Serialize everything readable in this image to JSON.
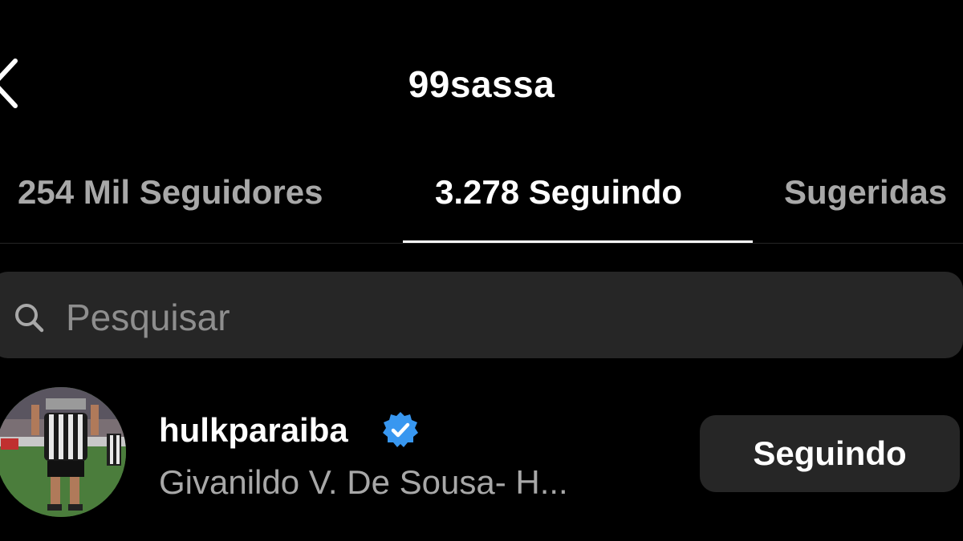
{
  "header": {
    "title": "99sassa",
    "back_icon": "chevron-left-icon"
  },
  "tabs": [
    {
      "label": "254 Mil Seguidores",
      "active": false
    },
    {
      "label": "3.278 Seguindo",
      "active": true
    },
    {
      "label": "Sugeridas",
      "active": false
    }
  ],
  "search": {
    "placeholder": "Pesquisar",
    "icon": "search-icon"
  },
  "following_list": [
    {
      "username": "hulkparaiba",
      "verified": true,
      "full_name": "Givanildo V. De Sousa- H...",
      "button_label": "Seguindo"
    }
  ],
  "colors": {
    "background": "#000000",
    "primary_text": "#ffffff",
    "secondary_text": "#a8a8a8",
    "surface": "#262626",
    "verified_blue": "#3897f0"
  }
}
